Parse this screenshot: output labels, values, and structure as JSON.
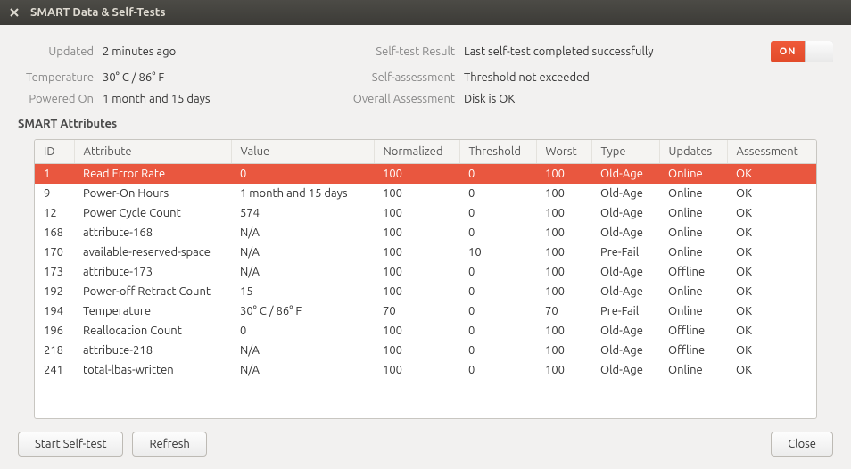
{
  "titlebar": {
    "title": "SMART Data & Self-Tests"
  },
  "info": {
    "updated_label": "Updated",
    "updated_value": "2 minutes ago",
    "temperature_label": "Temperature",
    "temperature_value": "30° C / 86° F",
    "poweredon_label": "Powered On",
    "poweredon_value": "1 month and 15 days",
    "selftest_label": "Self-test Result",
    "selftest_value": "Last self-test completed successfully",
    "selfassessment_label": "Self-assessment",
    "selfassessment_value": "Threshold not exceeded",
    "overall_label": "Overall Assessment",
    "overall_value": "Disk is OK",
    "toggle_on": "ON"
  },
  "section_title": "SMART Attributes",
  "columns": {
    "id": "ID",
    "attribute": "Attribute",
    "value": "Value",
    "normalized": "Normalized",
    "threshold": "Threshold",
    "worst": "Worst",
    "type": "Type",
    "updates": "Updates",
    "assessment": "Assessment"
  },
  "rows": [
    {
      "id": "1",
      "attribute": "Read Error Rate",
      "value": "0",
      "normalized": "100",
      "threshold": "0",
      "worst": "100",
      "type": "Old-Age",
      "updates": "Online",
      "assessment": "OK",
      "selected": true
    },
    {
      "id": "9",
      "attribute": "Power-On Hours",
      "value": "1 month and 15 days",
      "normalized": "100",
      "threshold": "0",
      "worst": "100",
      "type": "Old-Age",
      "updates": "Online",
      "assessment": "OK"
    },
    {
      "id": "12",
      "attribute": "Power Cycle Count",
      "value": "574",
      "normalized": "100",
      "threshold": "0",
      "worst": "100",
      "type": "Old-Age",
      "updates": "Online",
      "assessment": "OK"
    },
    {
      "id": "168",
      "attribute": "attribute-168",
      "value": "N/A",
      "normalized": "100",
      "threshold": "0",
      "worst": "100",
      "type": "Old-Age",
      "updates": "Online",
      "assessment": "OK"
    },
    {
      "id": "170",
      "attribute": "available-reserved-space",
      "value": "N/A",
      "normalized": "100",
      "threshold": "10",
      "worst": "100",
      "type": "Pre-Fail",
      "updates": "Online",
      "assessment": "OK"
    },
    {
      "id": "173",
      "attribute": "attribute-173",
      "value": "N/A",
      "normalized": "100",
      "threshold": "0",
      "worst": "100",
      "type": "Old-Age",
      "updates": "Offline",
      "assessment": "OK"
    },
    {
      "id": "192",
      "attribute": "Power-off Retract Count",
      "value": "15",
      "normalized": "100",
      "threshold": "0",
      "worst": "100",
      "type": "Old-Age",
      "updates": "Online",
      "assessment": "OK"
    },
    {
      "id": "194",
      "attribute": "Temperature",
      "value": "30° C / 86° F",
      "normalized": "70",
      "threshold": "0",
      "worst": "70",
      "type": "Pre-Fail",
      "updates": "Online",
      "assessment": "OK"
    },
    {
      "id": "196",
      "attribute": "Reallocation Count",
      "value": "0",
      "normalized": "100",
      "threshold": "0",
      "worst": "100",
      "type": "Old-Age",
      "updates": "Offline",
      "assessment": "OK"
    },
    {
      "id": "218",
      "attribute": "attribute-218",
      "value": "N/A",
      "normalized": "100",
      "threshold": "0",
      "worst": "100",
      "type": "Old-Age",
      "updates": "Offline",
      "assessment": "OK"
    },
    {
      "id": "241",
      "attribute": "total-lbas-written",
      "value": "N/A",
      "normalized": "100",
      "threshold": "0",
      "worst": "100",
      "type": "Old-Age",
      "updates": "Online",
      "assessment": "OK"
    }
  ],
  "buttons": {
    "start": "Start Self-test",
    "refresh": "Refresh",
    "close": "Close"
  }
}
